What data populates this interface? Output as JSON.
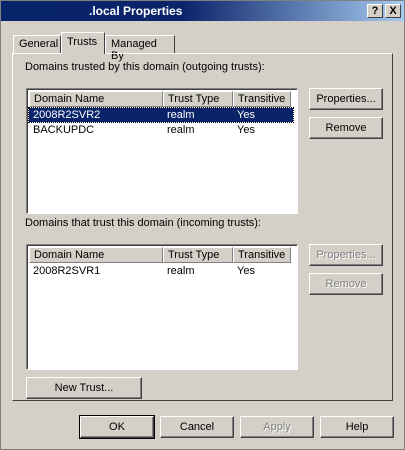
{
  "window": {
    "title": ".local Properties",
    "help_button": "?",
    "close_button": "X"
  },
  "tabs": [
    {
      "label": "General",
      "active": false
    },
    {
      "label": "Trusts",
      "active": true
    },
    {
      "label": "Managed By",
      "active": false
    }
  ],
  "outgoing": {
    "label": "Domains trusted by this domain (outgoing trusts):",
    "columns": [
      "Domain Name",
      "Trust Type",
      "Transitive"
    ],
    "rows": [
      {
        "domain": "2008R2SVR2",
        "type": "realm",
        "transitive": "Yes",
        "selected": true
      },
      {
        "domain": "BACKUPDC",
        "type": "realm",
        "transitive": "Yes",
        "selected": false
      }
    ],
    "properties_button": "Properties...",
    "remove_button": "Remove"
  },
  "incoming": {
    "label": "Domains that trust this domain (incoming trusts):",
    "columns": [
      "Domain Name",
      "Trust Type",
      "Transitive"
    ],
    "rows": [
      {
        "domain": "2008R2SVR1",
        "type": "realm",
        "transitive": "Yes",
        "selected": false
      }
    ],
    "properties_button": "Properties...",
    "remove_button": "Remove"
  },
  "new_trust_button": "New Trust...",
  "footer": {
    "ok": "OK",
    "cancel": "Cancel",
    "apply": "Apply",
    "help": "Help"
  }
}
